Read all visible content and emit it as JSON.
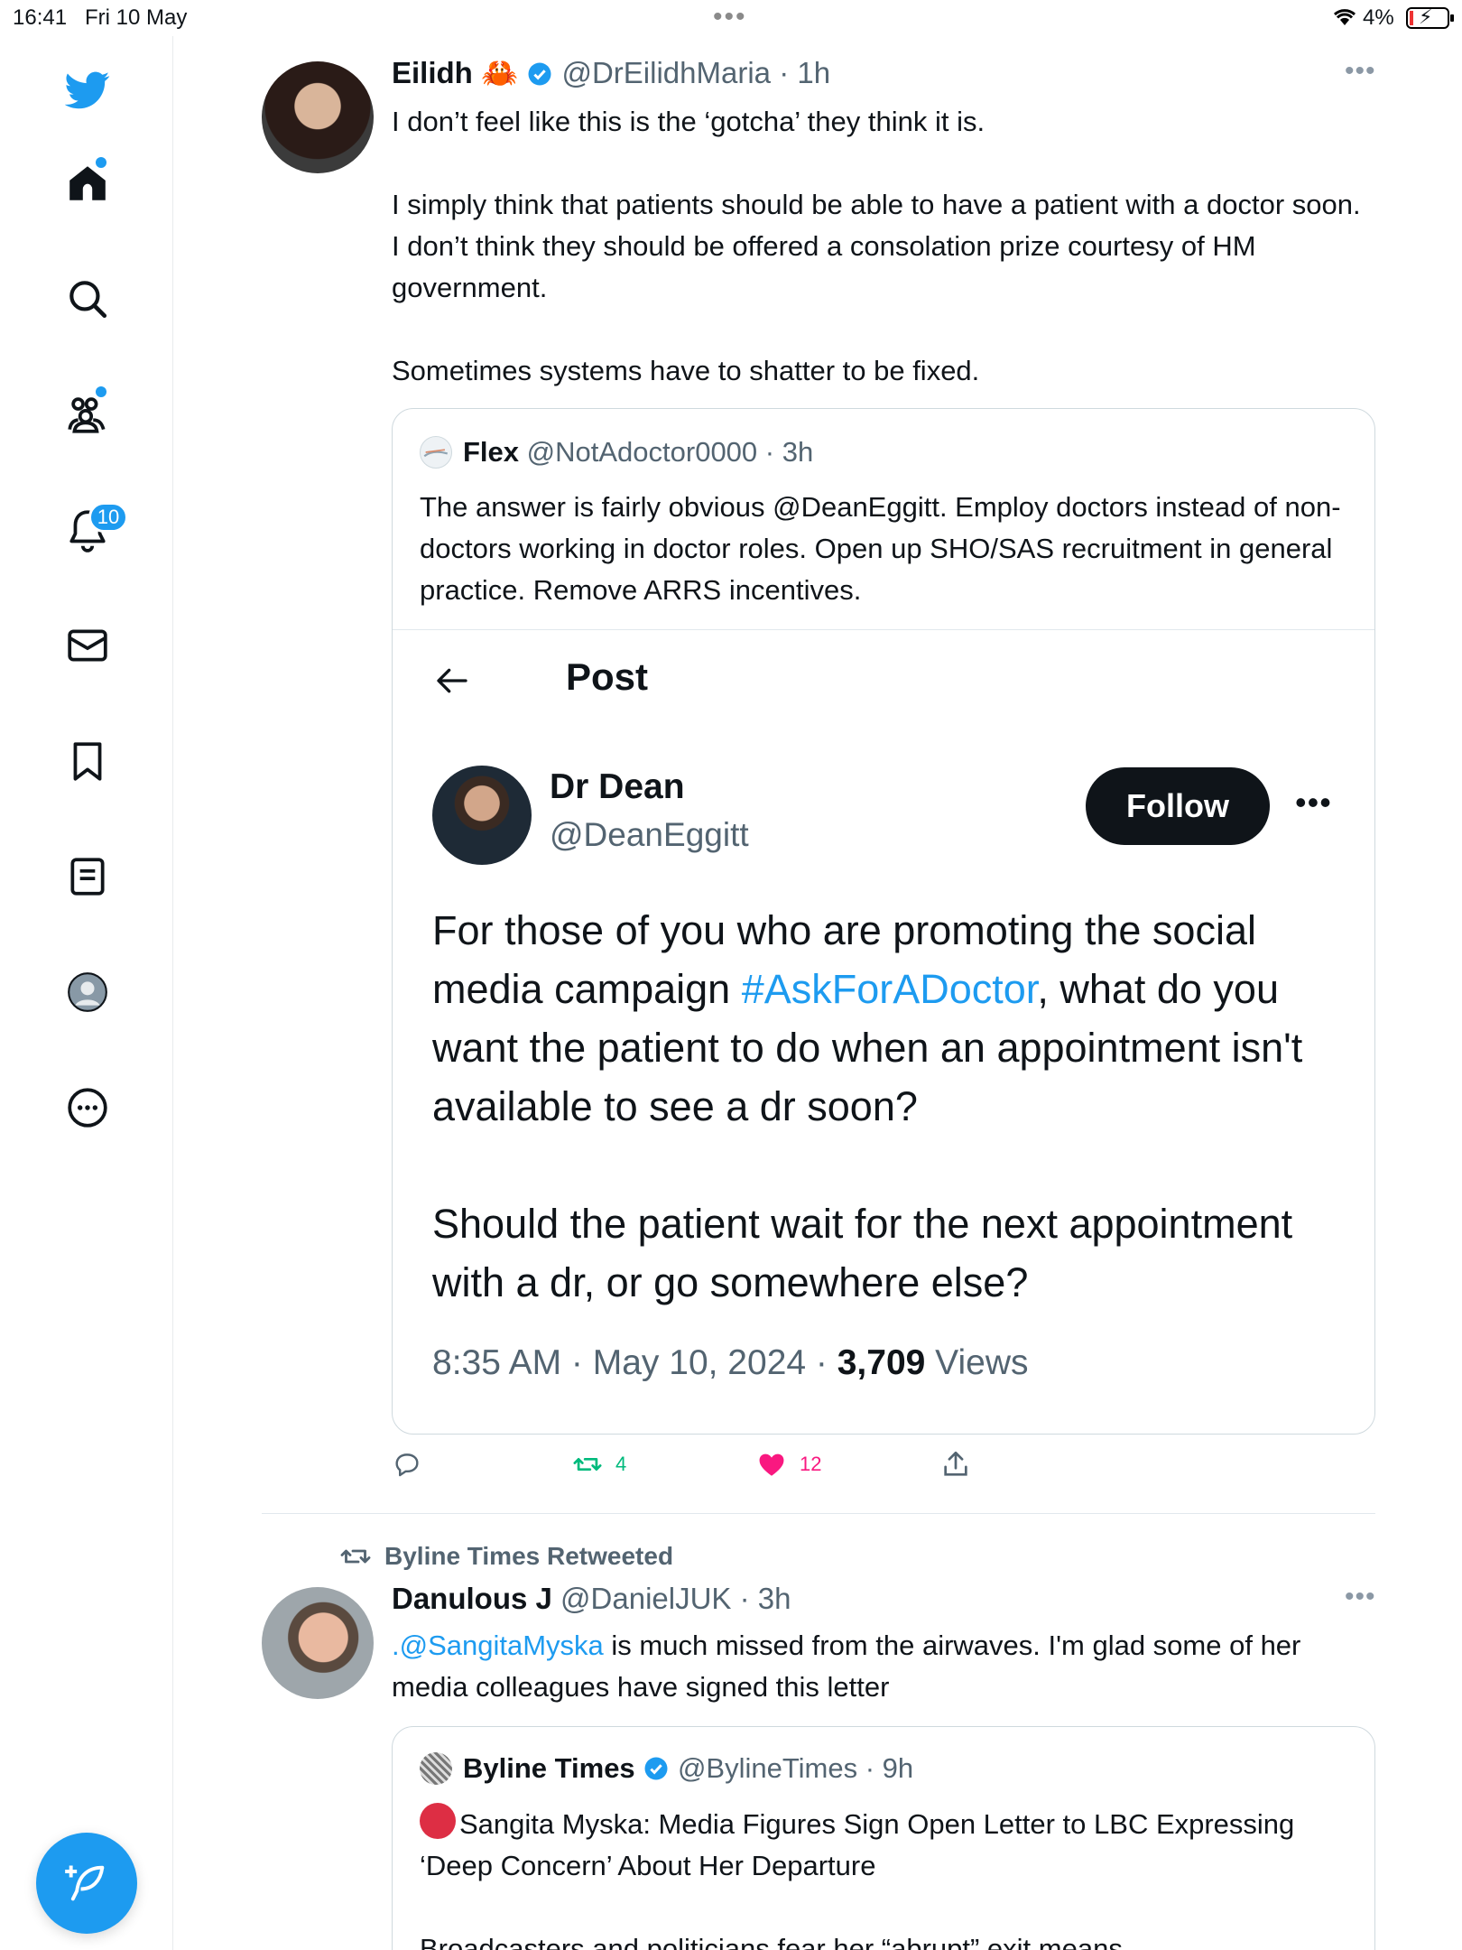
{
  "status_bar": {
    "time": "16:41",
    "date": "Fri 10 May",
    "battery": "4%"
  },
  "sidebar": {
    "notifications_badge": "10"
  },
  "tweet1": {
    "name": "Eilidh",
    "emoji": "🦀",
    "handle": "@DrEilidhMaria",
    "time": "· 1h",
    "body": [
      "I don’t feel like this is the ‘gotcha’ they think it is.",
      "I simply think that patients should be able to have a patient with a doctor soon. I don’t think they should be offered a consolation prize courtesy of HM government.",
      "Sometimes systems have to shatter to be fixed."
    ],
    "quote": {
      "name": "Flex",
      "handle": "@NotAdoctor0000",
      "time": "· 3h",
      "body": "The answer is fairly obvious @DeanEggitt. Employ doctors instead of non-doctors working in doctor roles. Open up SHO/SAS recruitment in general practice. Remove ARRS incentives.",
      "screenshot": {
        "header_title": "Post",
        "name": "Dr Dean",
        "handle": "@DeanEggitt",
        "follow_label": "Follow",
        "body_before_tag": "For those of you who are promoting the social media campaign ",
        "hashtag": "#AskForADoctor",
        "body_after_tag": ", what do you want the patient to do when an appointment isn't available to see a dr soon?",
        "body2": "Should the patient wait for the next appointment with a dr, or go somewhere else?",
        "meta_time": "8:35 AM · May 10, 2024 · ",
        "views_count": "3,709",
        "views_label": " Views"
      }
    },
    "actions": {
      "retweets": "4",
      "likes": "12"
    },
    "colors": {
      "retweet": "#00ba7c",
      "like": "#f91880"
    }
  },
  "tweet2": {
    "retweeted_by": "Byline Times Retweeted",
    "name": "Danulous J",
    "handle": "@DanielJUK",
    "time": "· 3h",
    "mention": ".@SangitaMyska",
    "body": " is much missed from the airwaves. I'm glad some of her media colleagues have signed this letter",
    "quote": {
      "name": "Byline Times",
      "handle": "@BylineTimes",
      "time": "· 9h",
      "headline": "Sangita Myska: Media Figures Sign Open Letter to LBC Expressing ‘Deep Concern’ About Her Departure",
      "body2": "Broadcasters and politicians fear her “abrupt” exit means"
    }
  }
}
